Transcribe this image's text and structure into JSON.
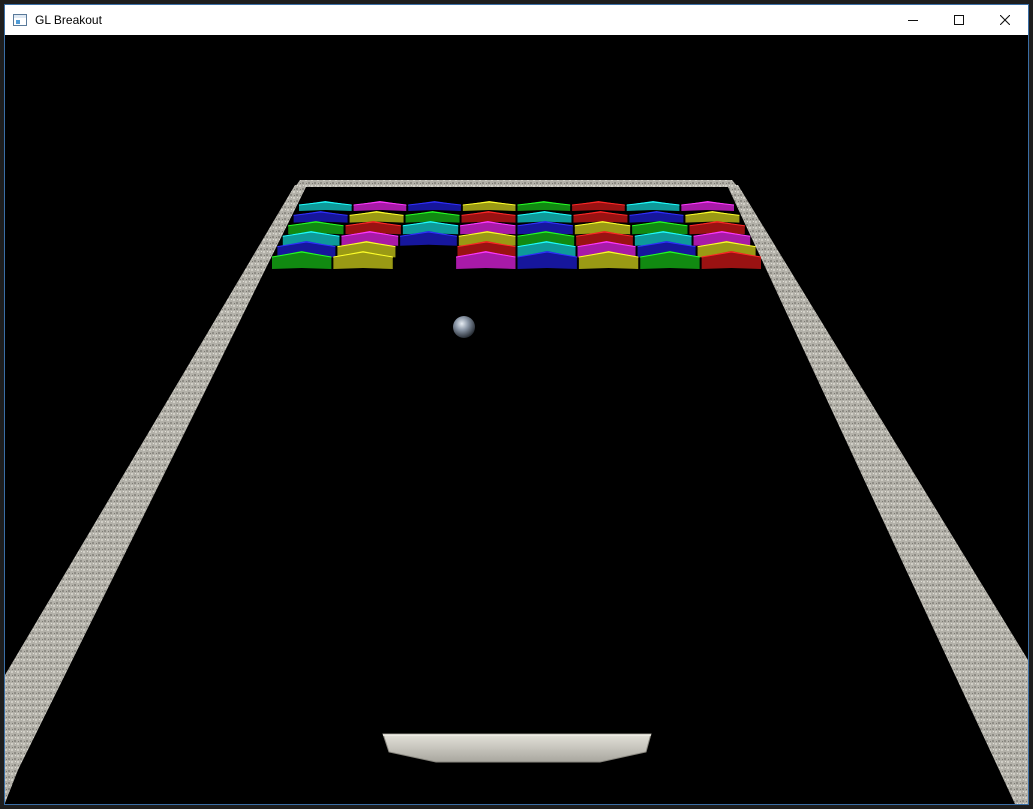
{
  "window": {
    "title": "GL Breakout",
    "controls": {
      "minimize_icon": "minimize-icon",
      "maximize_icon": "maximize-icon",
      "close_icon": "close-icon"
    }
  },
  "game": {
    "background": "#000000",
    "wall_color": "#b8b6ae",
    "paddle_color": "#c9c7c0",
    "ball_color": "#8a96a6",
    "brick_rows": [
      [
        "cyan",
        "magenta",
        "blue",
        "olive",
        "green",
        "red",
        "cyan",
        "magenta"
      ],
      [
        "blue",
        "olive",
        "green",
        "red",
        "cyan",
        "red",
        "blue",
        "olive"
      ],
      [
        "green",
        "red",
        "cyan",
        "magenta",
        "blue",
        "olive",
        "green",
        "red"
      ],
      [
        "cyan",
        "magenta",
        "blue",
        "olive",
        "green",
        "red",
        "cyan",
        "magenta"
      ],
      [
        "blue",
        "olive",
        "",
        "red",
        "cyan",
        "magenta",
        "blue",
        "olive"
      ],
      [
        "green",
        "olive",
        "",
        "magenta",
        "blue",
        "olive",
        "green",
        "red"
      ]
    ],
    "brick_colors": {
      "cyan": "#0e9a9a",
      "magenta": "#a81aa8",
      "blue": "#16169c",
      "olive": "#9a9a14",
      "green": "#118a11",
      "red": "#9a1212"
    }
  }
}
